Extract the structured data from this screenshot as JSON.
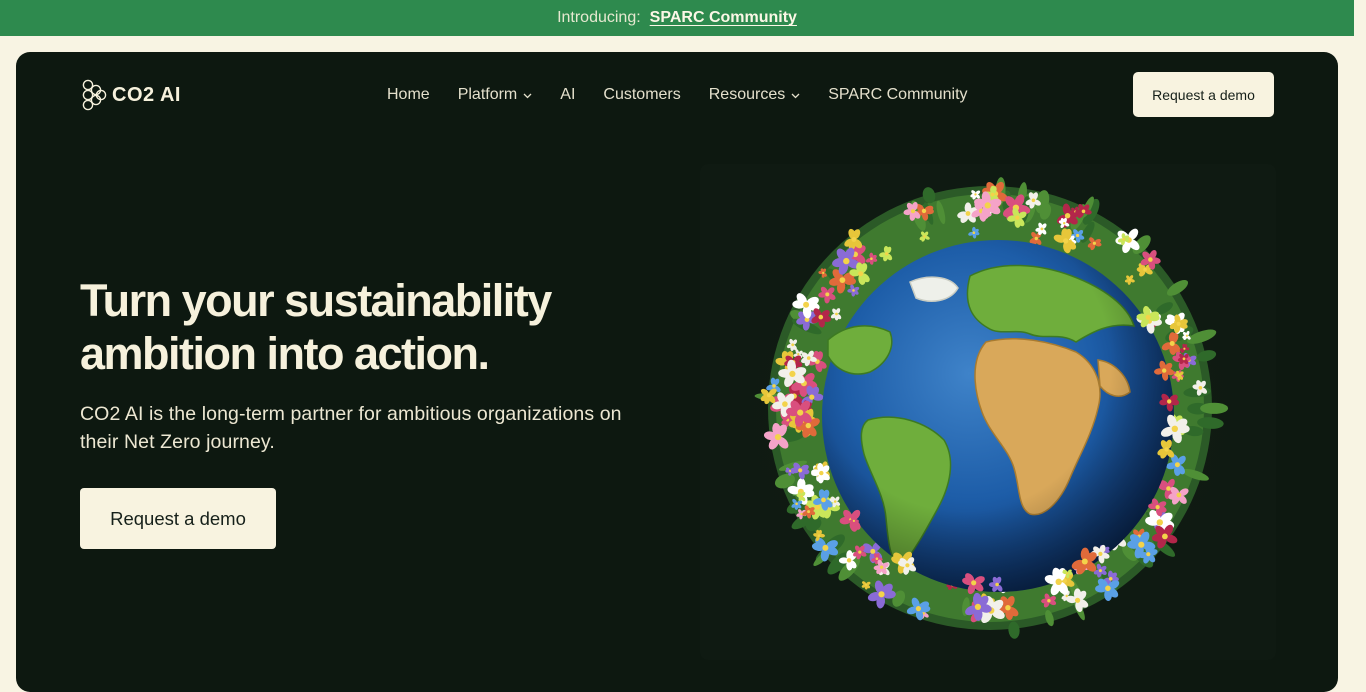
{
  "announcement": {
    "intro": "Introducing:",
    "link": "SPARC Community"
  },
  "brand": {
    "name": "CO2 AI",
    "logo_icon": "interlocking-rings-icon"
  },
  "nav": {
    "items": [
      {
        "label": "Home",
        "has_dropdown": false
      },
      {
        "label": "Platform",
        "has_dropdown": true
      },
      {
        "label": "AI",
        "has_dropdown": false
      },
      {
        "label": "Customers",
        "has_dropdown": false
      },
      {
        "label": "Resources",
        "has_dropdown": true
      },
      {
        "label": "SPARC Community",
        "has_dropdown": false
      }
    ],
    "cta": "Request a demo"
  },
  "hero": {
    "headline": "Turn your sustainability ambition into action.",
    "subtext": "CO2 AI is the long-term partner for ambitious organizations on their Net Zero journey.",
    "cta": "Request a demo",
    "image": "flower-covered-earth-globe"
  },
  "colors": {
    "announcement_bg": "#2e8a4e",
    "page_bg": "#f8f4e3",
    "hero_bg": "#0d1810",
    "cream": "#f8f3e0",
    "text_light": "#f6f1dc"
  }
}
